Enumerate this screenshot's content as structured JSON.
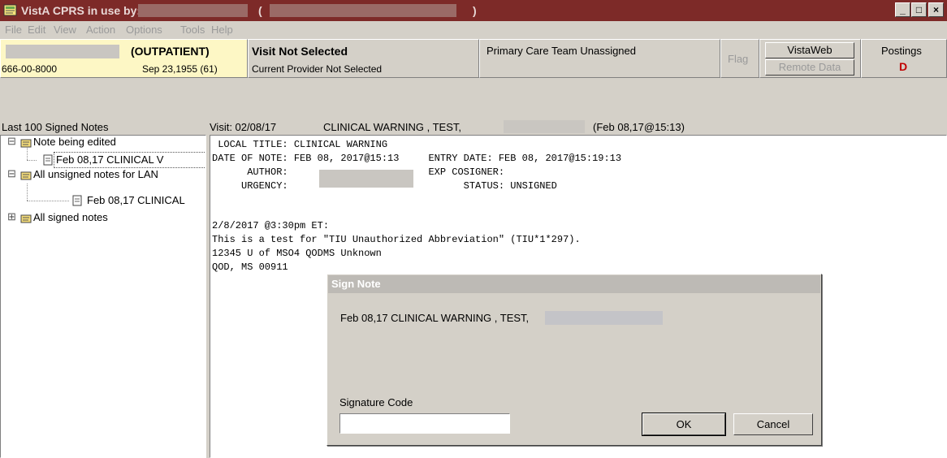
{
  "window": {
    "title": "VistA CPRS in use by:",
    "title_paren_open": "(",
    "title_paren_close": ")",
    "buttons": {
      "minimize": "_",
      "maximize": "□",
      "close": "×"
    }
  },
  "menu": [
    "File",
    "Edit",
    "View",
    "Action",
    "Options",
    "Tools",
    "Help"
  ],
  "header": {
    "patient": {
      "status": "(OUTPATIENT)",
      "ssn": "666-00-8000",
      "dob": "Sep 23,1955 (61)"
    },
    "visit": {
      "title": "Visit Not Selected",
      "provider": "Current Provider Not Selected"
    },
    "team": "Primary Care Team Unassigned",
    "flag": "Flag",
    "vistaweb": "VistaWeb",
    "remote_data": "Remote Data",
    "postings": {
      "label": "Postings",
      "value": "D"
    }
  },
  "notes_panel": {
    "header": "Last 100 Signed Notes",
    "tree": [
      {
        "label": "Note being edited",
        "expander": "⊟"
      },
      {
        "label": "Feb 08,17  CLINICAL V"
      },
      {
        "label": "All unsigned notes for LAN",
        "expander": "⊟"
      },
      {
        "label": "Feb 08,17  CLINICAL"
      },
      {
        "label": "All signed notes",
        "expander": "⊞"
      }
    ]
  },
  "note_view": {
    "visit_label": "Visit: 02/08/17",
    "note_title": "CLINICAL WARNING , TEST,",
    "note_time": "(Feb 08,17@15:13)",
    "lines": [
      " LOCAL TITLE: CLINICAL WARNING",
      "DATE OF NOTE: FEB 08, 2017@15:13     ENTRY DATE: FEB 08, 2017@15:19:13",
      "      AUTHOR:                        EXP COSIGNER:",
      "     URGENCY:                              STATUS: UNSIGNED",
      "",
      "2/8/2017 @3:30pm ET:",
      "This is a test for \"TIU Unauthorized Abbreviation\" (TIU*1*297).",
      "12345 U of MSO4 QODMS Unknown",
      "QOD, MS 00911"
    ]
  },
  "dialog": {
    "title": "Sign Note",
    "note": "Feb 08,17  CLINICAL WARNING , TEST,",
    "signature_label": "Signature Code",
    "signature_value": "",
    "ok": "OK",
    "cancel": "Cancel"
  },
  "colors": {
    "titlebar": "#7d2a28",
    "patient_bg": "#fdf7c5",
    "dialog_title": "#bdbab5",
    "postings_value": "#c00000"
  }
}
